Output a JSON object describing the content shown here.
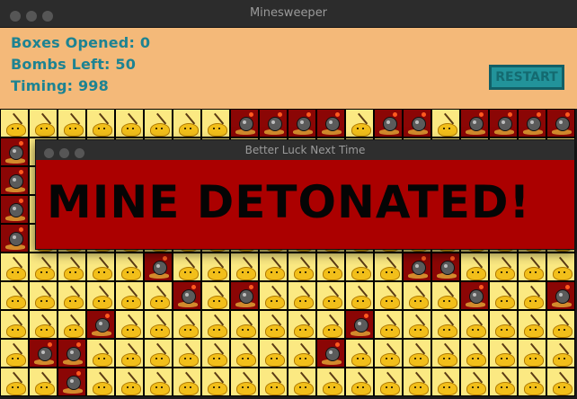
{
  "window": {
    "title": "Minesweeper"
  },
  "stats": {
    "boxes_opened": "Boxes Opened: 0",
    "bombs_left": "Bombs Left: 50",
    "timing": "Timing: 998"
  },
  "restart_label": "RESTART",
  "dialog": {
    "title": "Better Luck Next Time",
    "message": "MINE DETONATED!"
  },
  "board": {
    "state": "lost",
    "rows": 10,
    "cols": 20,
    "mines": [
      [
        0,
        8
      ],
      [
        0,
        9
      ],
      [
        0,
        10
      ],
      [
        0,
        11
      ],
      [
        0,
        13
      ],
      [
        0,
        14
      ],
      [
        0,
        16
      ],
      [
        0,
        17
      ],
      [
        0,
        18
      ],
      [
        0,
        19
      ],
      [
        1,
        0
      ],
      [
        2,
        0
      ],
      [
        3,
        0
      ],
      [
        4,
        0
      ],
      [
        5,
        5
      ],
      [
        5,
        14
      ],
      [
        5,
        15
      ],
      [
        6,
        6
      ],
      [
        6,
        8
      ],
      [
        6,
        16
      ],
      [
        6,
        19
      ],
      [
        7,
        3
      ],
      [
        7,
        12
      ],
      [
        8,
        1
      ],
      [
        8,
        2
      ],
      [
        8,
        11
      ],
      [
        9,
        2
      ]
    ]
  },
  "colors": {
    "header_bg": "#f4b979",
    "stat_text": "#1d8392",
    "dialog_bg": "#ab0000",
    "closed_cell": "#fbe982",
    "mine_cell": "#8b0605"
  }
}
